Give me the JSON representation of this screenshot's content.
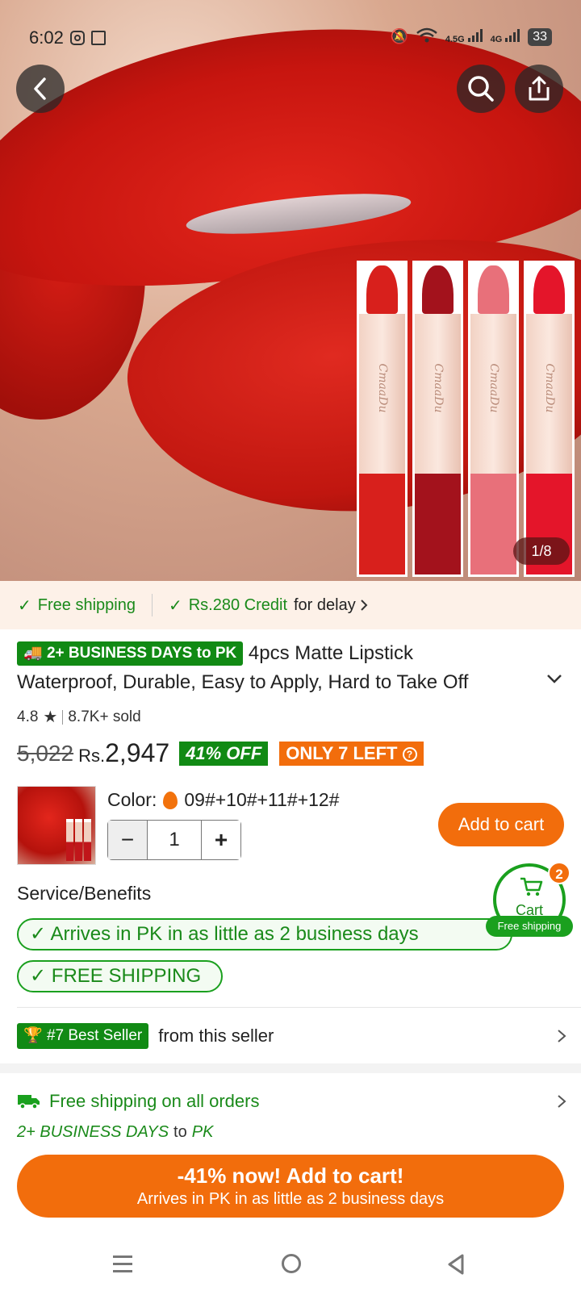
{
  "status_bar": {
    "time": "6:02",
    "network1": "4.5G",
    "network2": "4G",
    "battery": "33"
  },
  "gallery": {
    "counter": "1/8",
    "brand": "CmaaDu"
  },
  "info_bar": {
    "free_shipping": "Free shipping",
    "credit": "Rs.280 Credit",
    "credit_suffix": "for delay"
  },
  "product": {
    "delivery_badge": "2+ BUSINESS DAYS to PK",
    "title": "4pcs Matte Lipstick Waterproof, Durable, Easy to Apply, Hard to Take Off",
    "rating": "4.8",
    "sold": "8.7K+ sold",
    "old_price": "5,022",
    "currency": "Rs.",
    "price": "2,947",
    "discount": "41% OFF",
    "stock": "ONLY 7 LEFT"
  },
  "variant": {
    "color_label": "Color:",
    "color_value": "09#+10#+11#+12#",
    "quantity": "1"
  },
  "add_to_cart_label": "Add to cart",
  "cart": {
    "label": "Cart",
    "count": "2",
    "badge": "Free shipping"
  },
  "service": {
    "title": "Service/Benefits",
    "benefits": [
      "Arrives in PK in as little as 2 business days",
      "FREE SHIPPING"
    ]
  },
  "best_seller": {
    "badge": "#7 Best Seller",
    "text": "from this seller"
  },
  "shipping": {
    "title": "Free shipping on all orders",
    "days": "2+ BUSINESS DAYS",
    "to": "to",
    "dest": "PK"
  },
  "cta": {
    "line1": "-41% now! Add to cart!",
    "line2": "Arrives in PK in as little as 2 business days"
  },
  "colors": {
    "accent": "#f26d0c",
    "green": "#118a14",
    "lipstick_shades": [
      "#d8201c",
      "#a3121c",
      "#e8707a",
      "#e4152a"
    ]
  }
}
